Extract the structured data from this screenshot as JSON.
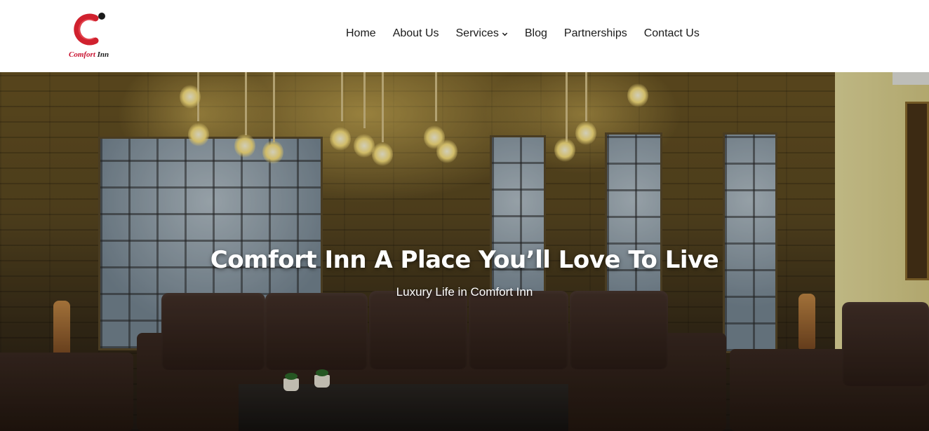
{
  "brand": {
    "logo_name": "Comfort",
    "logo_suffix": "Inn",
    "accent_color": "#d0212e"
  },
  "nav": {
    "items": [
      {
        "label": "Home"
      },
      {
        "label": "About Us"
      },
      {
        "label": "Services",
        "has_dropdown": true
      },
      {
        "label": "Blog"
      },
      {
        "label": "Partnerships"
      },
      {
        "label": "Contact Us"
      }
    ],
    "dropdown_icon": "chevron-down-icon"
  },
  "hero": {
    "title": "Comfort Inn A Place You’ll Love To Live",
    "subtitle": "Luxury Life in Comfort Inn"
  }
}
